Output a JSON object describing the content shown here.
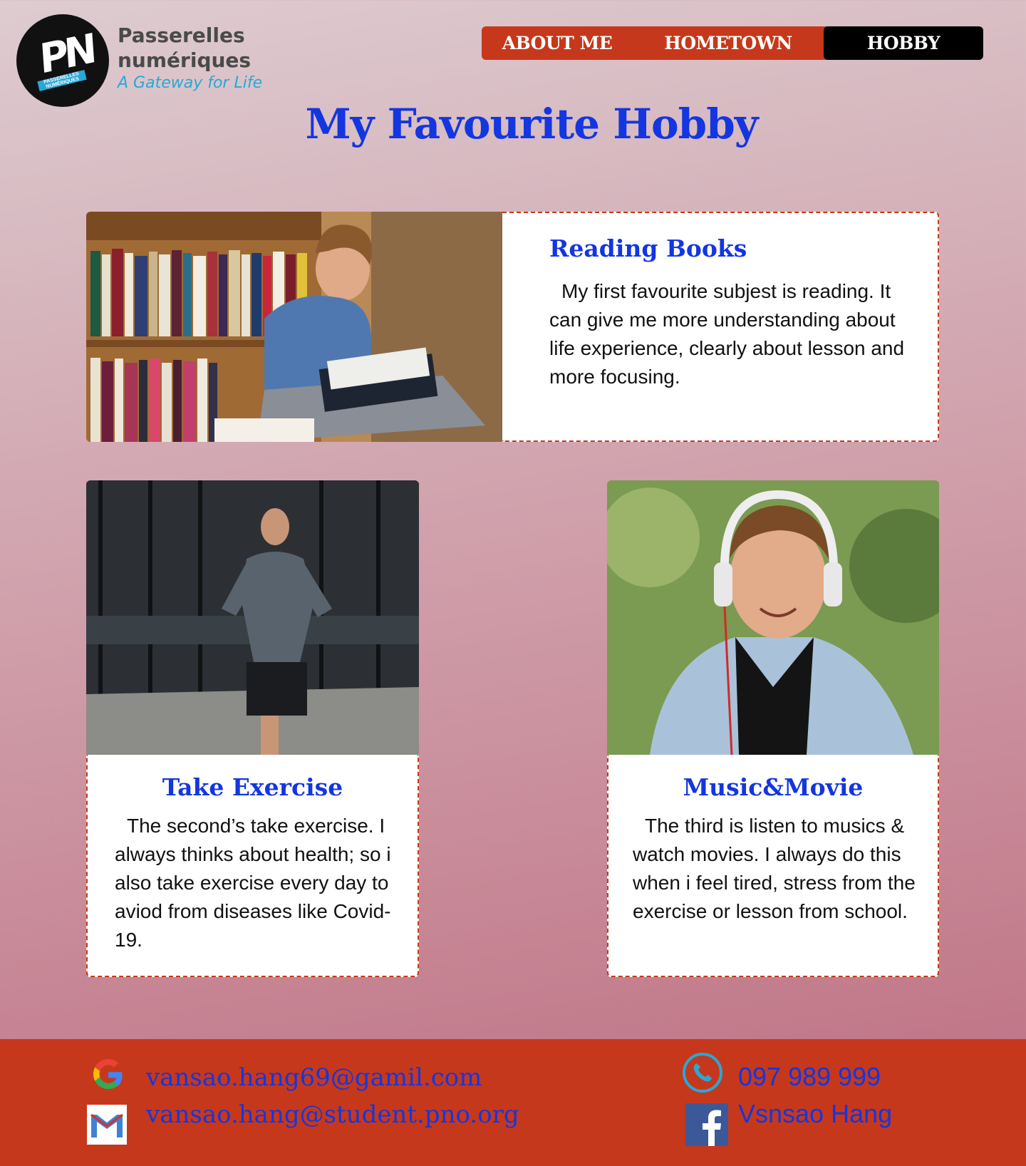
{
  "header": {
    "logo_letters": "PN",
    "logo_band_text": "PASSERELLES NUMÉRIQUES",
    "brand_name": "Passerelles numériques",
    "brand_tagline": "A Gateway for Life"
  },
  "nav": {
    "items": [
      {
        "label": "ABOUT ME",
        "active": false
      },
      {
        "label": "HOMETOWN",
        "active": false
      },
      {
        "label": "HOBBY",
        "active": true
      }
    ]
  },
  "page": {
    "title": "My Favourite Hobby"
  },
  "hobbies": [
    {
      "title": "Reading Books",
      "text": "My first favourite subjest is reading. It can give me more understanding about life experience, clearly about lesson and more focusing.",
      "image": "student-reading-in-library-photo"
    },
    {
      "title": "Take Exercise",
      "text": "The second’s take exercise. I always thinks about health; so i also take exercise every day to aviod from diseases like Covid-19.",
      "image": "man-jogging-photo"
    },
    {
      "title": "Music&Movie",
      "text": "The third is listen to musics & watch movies. I always do this when i feel tired, stress from the exercise or lesson from school.",
      "image": "man-with-headphones-photo"
    }
  ],
  "footer": {
    "background": "#c6381b",
    "google_email": "vansao.hang69@gamil.com",
    "student_email": "vansao.hang@student.pno.org",
    "phone": "097 989 999",
    "facebook": "Vsnsao Hang"
  },
  "colors": {
    "accent": "#c6381b",
    "title_blue": "#1336e0",
    "nav_active": "#000000"
  }
}
